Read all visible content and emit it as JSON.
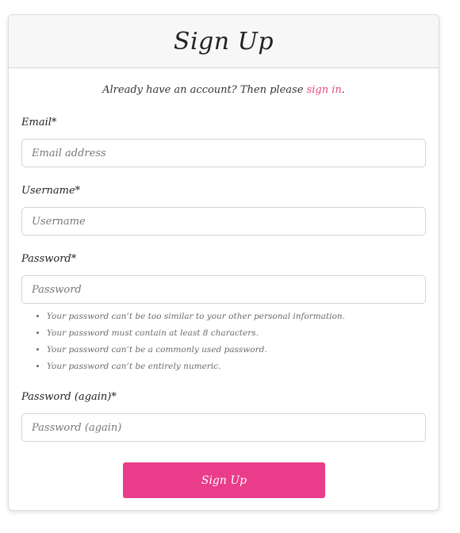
{
  "header": {
    "title": "Sign Up"
  },
  "signin": {
    "prefix": "Already have an account? Then please ",
    "link_label": "sign in",
    "suffix": "."
  },
  "fields": {
    "email": {
      "label": "Email*",
      "placeholder": "Email address",
      "value": ""
    },
    "username": {
      "label": "Username*",
      "placeholder": "Username",
      "value": ""
    },
    "password": {
      "label": "Password*",
      "placeholder": "Password",
      "value": ""
    },
    "password_again": {
      "label": "Password (again)*",
      "placeholder": "Password (again)",
      "value": ""
    }
  },
  "password_help": [
    "Your password can’t be too similar to your other personal information.",
    "Your password must contain at least 8 characters.",
    "Your password can’t be a commonly used password.",
    "Your password can’t be entirely numeric."
  ],
  "submit": {
    "label": "Sign Up"
  },
  "colors": {
    "accent": "#e93c8a",
    "link": "#e8457e",
    "header_bg": "#f7f7f8"
  }
}
